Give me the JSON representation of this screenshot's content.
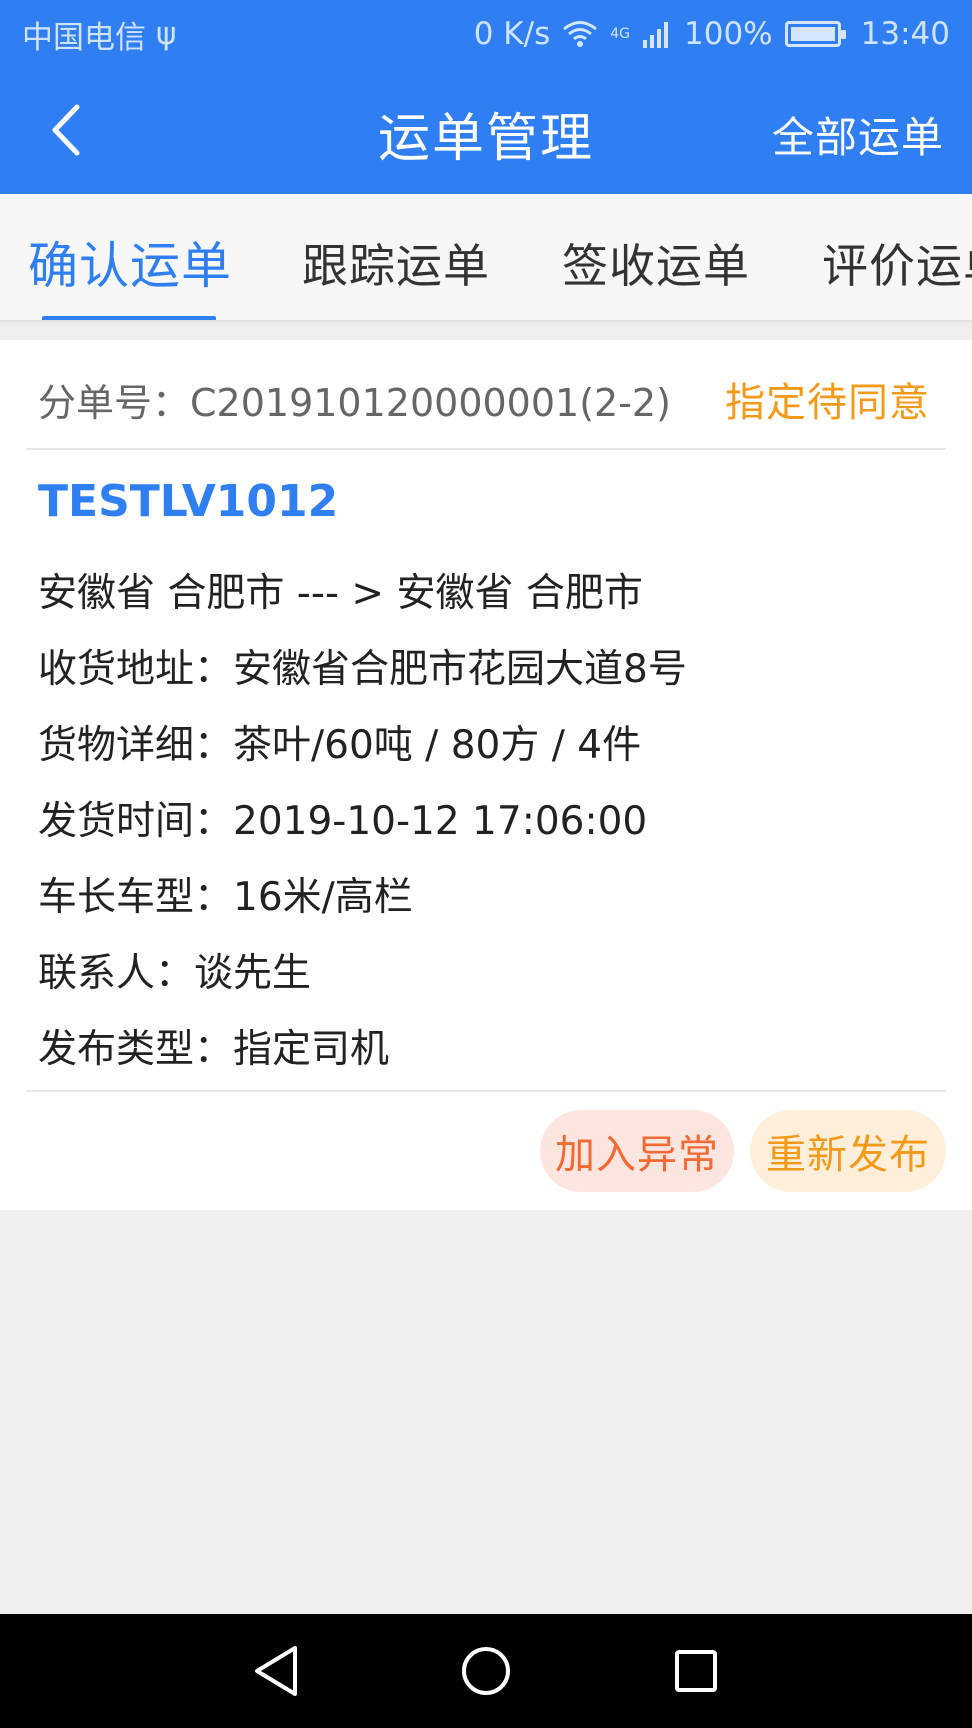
{
  "status_bar": {
    "carrier": "中国电信",
    "usb_symbol": "ψ",
    "speed": "0 K/s",
    "network": "4G",
    "battery": "100%",
    "time": "13:40"
  },
  "header": {
    "title": "运单管理",
    "right_action": "全部运单",
    "back_icon": "chevron-left-icon"
  },
  "tabs": [
    {
      "label": "确认运单",
      "active": true
    },
    {
      "label": "跟踪运单",
      "active": false
    },
    {
      "label": "签收运单",
      "active": false
    },
    {
      "label": "评价运单",
      "active": false
    }
  ],
  "order": {
    "number_label": "分单号：",
    "number": "C201910120000001(2-2)",
    "status": "指定待同意",
    "code": "TESTLV1012",
    "route": "安徽省 合肥市 --- >  安徽省 合肥市",
    "address_label": "收货地址：",
    "address": "安徽省合肥市花园大道8号",
    "goods_label": "货物详细：",
    "goods": "茶叶/60吨 / 80方 / 4件",
    "ship_time_label": "发货时间：",
    "ship_time": "2019-10-12 17:06:00",
    "vehicle_label": "车长车型：",
    "vehicle": "16米/高栏",
    "contact_label": "联系人：",
    "contact": "谈先生",
    "publish_type_label": "发布类型：",
    "publish_type": "指定司机",
    "actions": {
      "exception": "加入异常",
      "republish": "重新发布"
    }
  },
  "colors": {
    "primary": "#2f7ff2",
    "status_orange": "#f39a1b",
    "exception_red": "#f36a33"
  }
}
